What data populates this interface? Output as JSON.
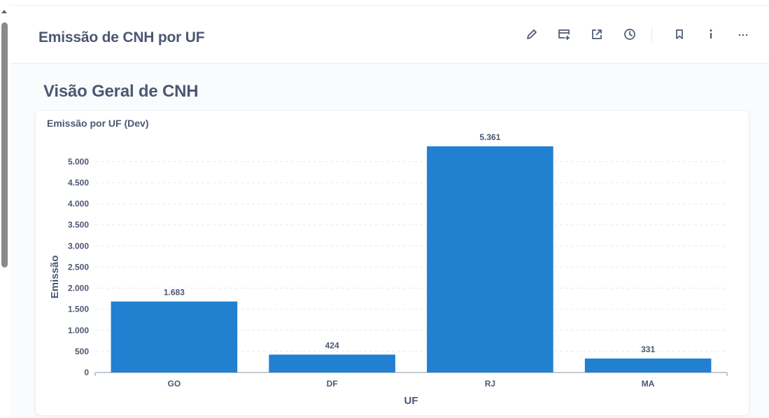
{
  "header": {
    "title": "Emissão de CNH por UF"
  },
  "toolbar": {
    "icons": [
      "pencil-icon",
      "add-to-dashboard-icon",
      "share-icon",
      "history-icon",
      "bookmark-icon",
      "info-icon",
      "more-icon"
    ]
  },
  "section": {
    "title": "Visão Geral de CNH"
  },
  "card": {
    "title": "Emissão por UF (Dev)"
  },
  "colors": {
    "bar": "#2180d0",
    "text": "#4c5773",
    "grid": "#e6e9ee"
  },
  "chart_data": {
    "type": "bar",
    "categories": [
      "GO",
      "DF",
      "RJ",
      "MA"
    ],
    "values": [
      1683,
      424,
      5361,
      331
    ],
    "value_labels": [
      "1.683",
      "424",
      "5.361",
      "331"
    ],
    "xlabel": "UF",
    "ylabel": "Emissão",
    "ylim": [
      0,
      5361
    ],
    "yticks": [
      0,
      500,
      1000,
      1500,
      2000,
      2500,
      3000,
      3500,
      4000,
      4500,
      5000
    ],
    "ytick_labels": [
      "0",
      "500",
      "1.000",
      "1.500",
      "2.000",
      "2.500",
      "3.000",
      "3.500",
      "4.000",
      "4.500",
      "5.000"
    ],
    "grid": true,
    "legend": "none"
  }
}
